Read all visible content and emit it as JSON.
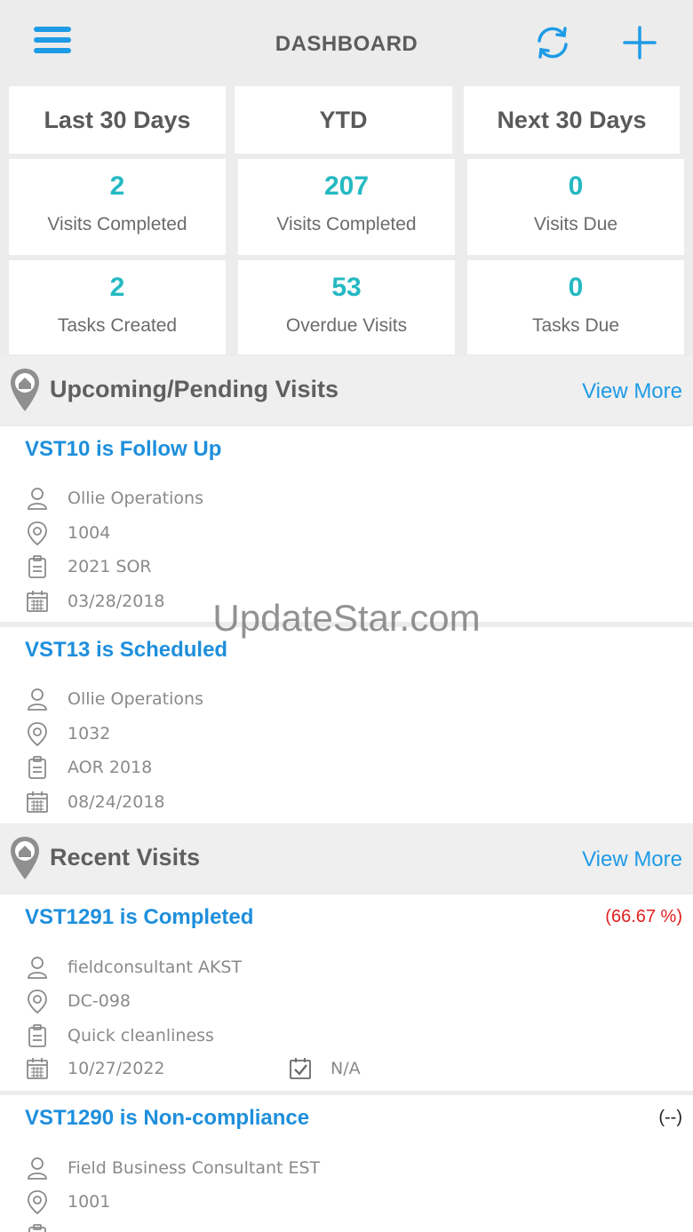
{
  "header": {
    "title": "DASHBOARD"
  },
  "tabs": [
    {
      "label": "Last 30 Days"
    },
    {
      "label": "YTD"
    },
    {
      "label": "Next 30 Days"
    }
  ],
  "stats": [
    {
      "value": "2",
      "label": "Visits Completed"
    },
    {
      "value": "207",
      "label": "Visits Completed"
    },
    {
      "value": "0",
      "label": "Visits Due"
    },
    {
      "value": "2",
      "label": "Tasks Created"
    },
    {
      "value": "53",
      "label": "Overdue Visits"
    },
    {
      "value": "0",
      "label": "Tasks Due"
    }
  ],
  "upcoming": {
    "title": "Upcoming/Pending Visits",
    "view_more": "View More",
    "visits": [
      {
        "title": "VST10 is Follow Up",
        "user": "Ollie Operations",
        "location": "1004",
        "form": "2021 SOR",
        "date": "03/28/2018"
      },
      {
        "title": "VST13 is Scheduled",
        "user": "Ollie Operations",
        "location": "1032",
        "form": "AOR 2018",
        "date": "08/24/2018"
      }
    ]
  },
  "recent": {
    "title": "Recent Visits",
    "view_more": "View More",
    "visits": [
      {
        "title": "VST1291 is Completed",
        "score": "(66.67 %)",
        "score_color": "#e02020",
        "user": "fieldconsultant AKST",
        "location": "DC-098",
        "form": "Quick cleanliness",
        "date": "10/27/2022",
        "task": "N/A"
      },
      {
        "title": "VST1290 is Non-compliance",
        "score": "(--)",
        "score_color": "#222222",
        "user": "Field Business Consultant EST",
        "location": "1001"
      }
    ]
  },
  "watermark": "UpdateStar.com",
  "colors": {
    "accent": "#1e9be6",
    "stat": "#25b9c2"
  }
}
